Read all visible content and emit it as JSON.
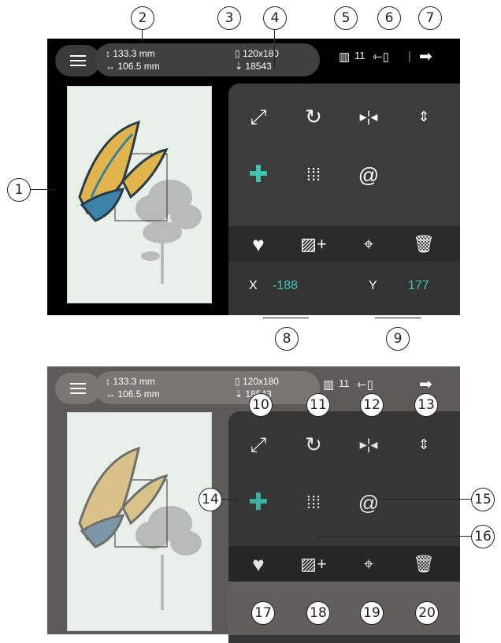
{
  "info": {
    "height_mm": "133.3 mm",
    "width_mm": "106.5 mm",
    "hoop": "120x180",
    "stitches": "18543"
  },
  "thread_count": "11",
  "coords": {
    "x_label": "X",
    "x_value": "-188",
    "y_label": "Y",
    "y_value": "177"
  },
  "callouts": [
    "1",
    "2",
    "3",
    "4",
    "5",
    "6",
    "7",
    "8",
    "9",
    "10",
    "11",
    "12",
    "13",
    "14",
    "15",
    "16",
    "17",
    "18",
    "19",
    "20"
  ],
  "colors": {
    "accent": "#3ec6b6",
    "panel": "#3c3c3c",
    "screen": "#000000"
  }
}
